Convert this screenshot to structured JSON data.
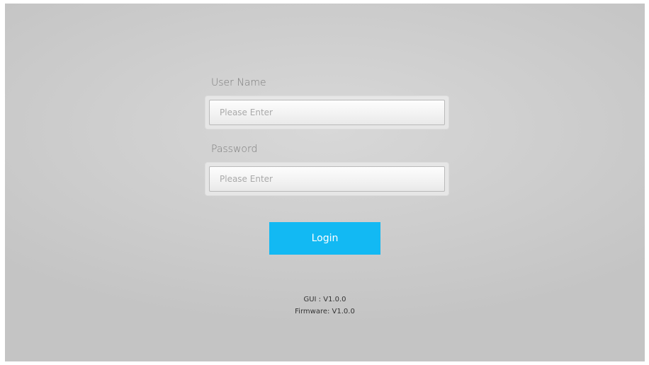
{
  "login": {
    "username_label": "User Name",
    "username_placeholder": "Please Enter",
    "password_label": "Password",
    "password_placeholder": "Please Enter",
    "login_button": "Login"
  },
  "footer": {
    "gui_version": "GUI : V1.0.0",
    "firmware_version": "Firmware: V1.0.0"
  },
  "colors": {
    "accent": "#12b9f3",
    "background": "#cfcfcf"
  }
}
